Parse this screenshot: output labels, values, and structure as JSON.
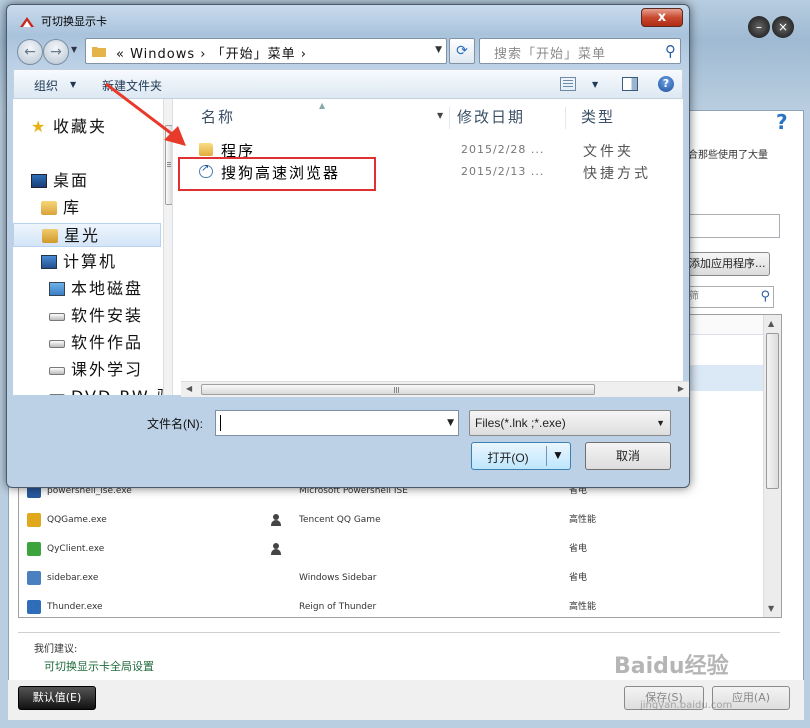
{
  "background_window": {
    "help_glyph": "?",
    "description": "合那些使用了大量",
    "add_app_button": "添加应用程序...",
    "filter_placeholder": "筛",
    "programs": [
      {
        "name": "powershell_ise.exe",
        "user_icon": false,
        "description": "Microsoft Powershell ISE",
        "preference": "省电",
        "icon_color": "#2a5a9e"
      },
      {
        "name": "QQGame.exe",
        "user_icon": true,
        "description": "Tencent QQ Game",
        "preference": "高性能",
        "icon_color": "#e2a81c"
      },
      {
        "name": "QyClient.exe",
        "user_icon": true,
        "description": "",
        "preference": "省电",
        "icon_color": "#3da43d"
      },
      {
        "name": "sidebar.exe",
        "user_icon": false,
        "description": "Windows Sidebar",
        "preference": "省电",
        "icon_color": "#4a7fc0"
      },
      {
        "name": "Thunder.exe",
        "user_icon": false,
        "description": "Reign of Thunder",
        "preference": "高性能",
        "icon_color": "#2f6db8"
      }
    ],
    "suggestion_label": "我们建议:",
    "global_settings_link": "可切换显示卡全局设置",
    "default_button": "默认值(E)",
    "save_button": "保存(S)",
    "apply_button": "应用(A)",
    "watermark": "Baidu经验",
    "watermark_sub": "jingyan.baidu.com"
  },
  "dialog": {
    "title": "可切换显示卡",
    "close_glyph": "x",
    "address": {
      "crumb": "« Windows › 「开始」菜单 ›",
      "search_placeholder": "搜索「开始」菜单"
    },
    "toolbar": {
      "organize": "组织",
      "new_folder": "新建文件夹",
      "help_glyph": "?"
    },
    "nav": [
      {
        "label": "收藏夹",
        "icon": "star-icon",
        "indent": 0,
        "selected": false
      },
      {
        "label": "桌面",
        "icon": "desktop-icon",
        "indent": 0,
        "selected": false
      },
      {
        "label": "库",
        "icon": "library-icon",
        "indent": 1,
        "selected": false
      },
      {
        "label": "星光",
        "icon": "user-folder-icon",
        "indent": 1,
        "selected": true
      },
      {
        "label": "计算机",
        "icon": "computer-icon",
        "indent": 1,
        "selected": false
      },
      {
        "label": "本地磁盘",
        "icon": "system-drive-icon",
        "indent": 2,
        "selected": false
      },
      {
        "label": "软件安装",
        "icon": "drive-icon",
        "indent": 2,
        "selected": false
      },
      {
        "label": "软件作品",
        "icon": "drive-icon",
        "indent": 2,
        "selected": false
      },
      {
        "label": "课外学习",
        "icon": "drive-icon",
        "indent": 2,
        "selected": false
      },
      {
        "label": "DVD RW 驱",
        "icon": "dvd-drive-icon",
        "indent": 2,
        "selected": false
      }
    ],
    "columns": {
      "name": "名称",
      "date": "修改日期",
      "type": "类型"
    },
    "files": [
      {
        "name": "程序",
        "date": "2015/2/28 ...",
        "type": "文件夹",
        "icon": "folder-icon"
      },
      {
        "name": "搜狗高速浏览器",
        "date": "2015/2/13 ...",
        "type": "快捷方式",
        "icon": "shortcut-icon"
      }
    ],
    "filename_label": "文件名(N):",
    "filename_value": "",
    "filetype_selected": "Files(*.lnk ;*.exe)",
    "open_button": "打开(O)",
    "cancel_button": "取消",
    "highlight_color": "#e03030"
  }
}
